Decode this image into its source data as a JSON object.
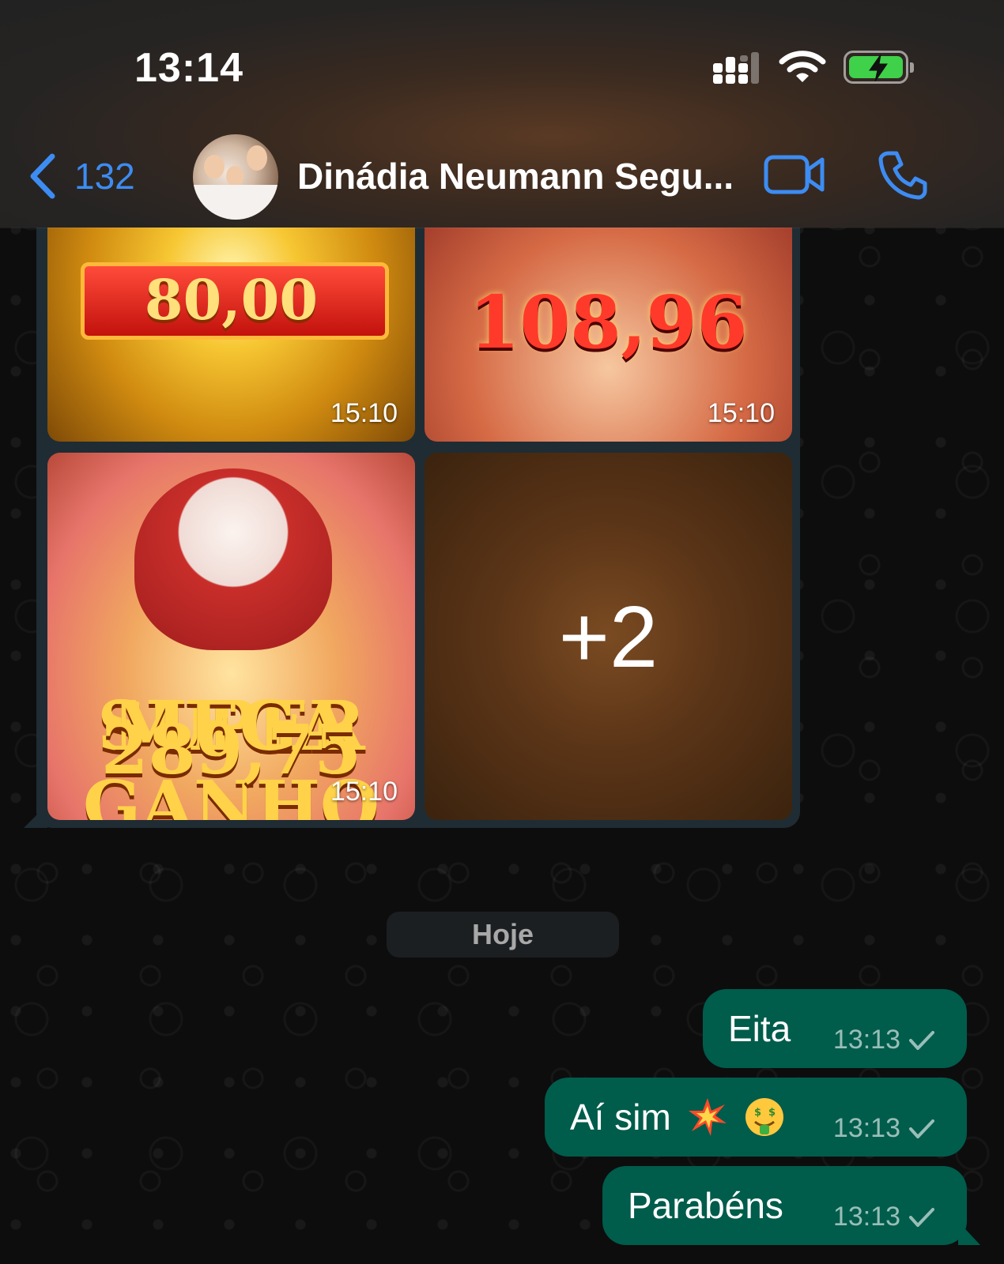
{
  "status_bar": {
    "time": "13:14"
  },
  "header": {
    "back_count": "132",
    "contact_name": "Dinádia Neumann Segu..."
  },
  "media_grid": {
    "tiles": [
      {
        "value": "80,00",
        "time": "15:10"
      },
      {
        "value": "108,96",
        "time": "15:10"
      },
      {
        "super_label": "SUPER",
        "mega_label": "MEGA GANHO",
        "value": "289,75",
        "time": "15:10"
      },
      {
        "more": "+2"
      }
    ]
  },
  "day_separator": "Hoje",
  "messages": [
    {
      "text": "Eita",
      "time": "13:13"
    },
    {
      "text": "Aí sim",
      "time": "13:13"
    },
    {
      "text": "Parabéns",
      "time": "13:13"
    }
  ],
  "colors": {
    "accent_blue": "#3d8cf2",
    "outgoing_bubble": "#005c4b",
    "battery_green": "#3fd14a"
  }
}
